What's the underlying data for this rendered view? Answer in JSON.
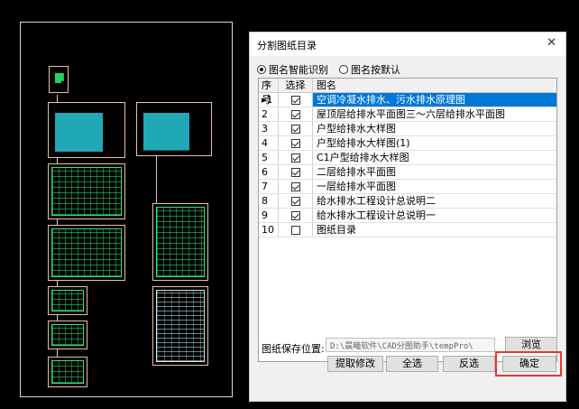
{
  "dialog": {
    "title": "分割图纸目录",
    "close_glyph": "✕",
    "mode_options": [
      {
        "label": "图名智能识别",
        "selected": true
      },
      {
        "label": "图名按默认",
        "selected": false
      }
    ],
    "table": {
      "headers": {
        "seq": "序号",
        "select": "选择",
        "name": "图名"
      },
      "current_row_marker": "▸",
      "rows": [
        {
          "seq": "1",
          "checked": true,
          "name": "空调冷凝水排水、污水排水原理图",
          "selected": true
        },
        {
          "seq": "2",
          "checked": true,
          "name": "屋顶层给排水平面图三～六层给排水平面图",
          "selected": false
        },
        {
          "seq": "3",
          "checked": true,
          "name": "户型给排水大样图",
          "selected": false
        },
        {
          "seq": "4",
          "checked": true,
          "name": "户型给排水大样图(1)",
          "selected": false
        },
        {
          "seq": "5",
          "checked": true,
          "name": "C1户型给排水大样图",
          "selected": false
        },
        {
          "seq": "6",
          "checked": true,
          "name": "二层给排水平面图",
          "selected": false
        },
        {
          "seq": "7",
          "checked": true,
          "name": "一层给排水平面图",
          "selected": false
        },
        {
          "seq": "8",
          "checked": true,
          "name": "给水排水工程设计总说明二",
          "selected": false
        },
        {
          "seq": "9",
          "checked": true,
          "name": "给水排水工程设计总说明一",
          "selected": false
        },
        {
          "seq": "10",
          "checked": false,
          "name": "图纸目录",
          "selected": false
        }
      ]
    },
    "save_path": {
      "label": "图纸保存位置:",
      "value": "D:\\晨曦软件\\CAD分图助手\\tempPro\\"
    },
    "buttons": {
      "browse": "浏览",
      "extract_edit": "提取修改",
      "select_all": "全选",
      "invert": "反选",
      "confirm": "确定"
    },
    "accent_color": "#0078d7",
    "highlight_color": "#e53935"
  }
}
